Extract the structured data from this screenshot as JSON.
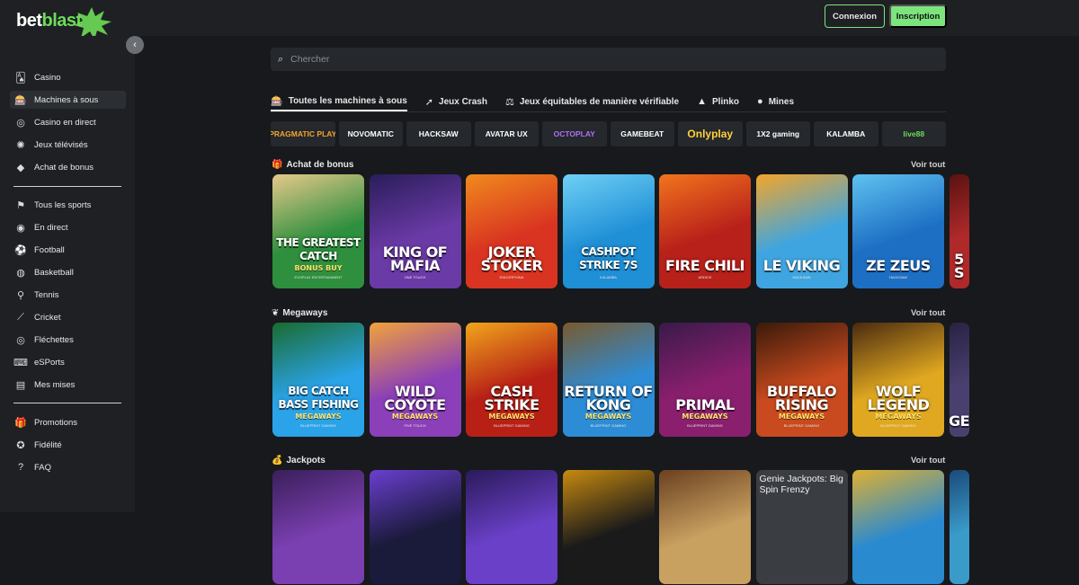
{
  "header": {
    "logo_part1": "bet",
    "logo_part2": "blast",
    "login_label": "Connexion",
    "signup_label": "Inscription"
  },
  "sidebar": {
    "items_top": [
      {
        "label": "Casino",
        "icon": "cards-icon"
      },
      {
        "label": "Machines à sous",
        "icon": "slot-machine-icon"
      },
      {
        "label": "Casino en direct",
        "icon": "roulette-icon"
      },
      {
        "label": "Jeux télévisés",
        "icon": "wheel-icon"
      },
      {
        "label": "Achat de bonus",
        "icon": "diamond-icon"
      }
    ],
    "items_sports": [
      {
        "label": "Tous les sports",
        "icon": "sports-icon"
      },
      {
        "label": "En direct",
        "icon": "live-icon"
      },
      {
        "label": "Football",
        "icon": "football-icon"
      },
      {
        "label": "Basketball",
        "icon": "basketball-icon"
      },
      {
        "label": "Tennis",
        "icon": "tennis-icon"
      },
      {
        "label": "Cricket",
        "icon": "cricket-icon"
      },
      {
        "label": "Fléchettes",
        "icon": "darts-icon"
      },
      {
        "label": "eSPorts",
        "icon": "gamepad-icon"
      },
      {
        "label": "Mes mises",
        "icon": "ticket-icon"
      }
    ],
    "items_bottom": [
      {
        "label": "Promotions",
        "icon": "gift-icon"
      },
      {
        "label": "Fidélité",
        "icon": "star-icon"
      },
      {
        "label": "FAQ",
        "icon": "faq-icon"
      }
    ]
  },
  "search": {
    "placeholder": "Chercher"
  },
  "tabs": [
    {
      "label": "Toutes les machines à sous",
      "icon": "slot-machine-icon"
    },
    {
      "label": "Jeux Crash",
      "icon": "rocket-icon"
    },
    {
      "label": "Jeux équitables de manière vérifiable",
      "icon": "scale-icon"
    },
    {
      "label": "Plinko",
      "icon": "triangle-icon"
    },
    {
      "label": "Mines",
      "icon": "bomb-icon"
    }
  ],
  "providers": [
    "PRAGMATIC PLAY",
    "NOVOMATIC",
    "HACKSAW",
    "AVATAR UX",
    "OCTOPLAY",
    "GAMEBEAT",
    "Onlyplay",
    "1X2 gaming",
    "KALAMBA",
    "live88"
  ],
  "sections": [
    {
      "title": "Achat de bonus",
      "icon": "gift-icon",
      "see_all": "Voir tout",
      "games": [
        {
          "t1": "THE GREATEST CATCH",
          "t2": "BONUS BUY",
          "t3": "EVOPLAY ENTERTAINMENT",
          "bg": "#2e8f3e",
          "bg2": "#e6c98a"
        },
        {
          "t1": "KING OF MAFIA",
          "t2": "",
          "t3": "ONE TOUCH",
          "bg": "#6a3aa6",
          "bg2": "#2a1d5a"
        },
        {
          "t1": "JOKER STOKER",
          "t2": "",
          "t3": "ENDORPHINA",
          "bg": "#d93421",
          "bg2": "#f08a1d"
        },
        {
          "t1": "CASHPOT STRIKE 7S",
          "t2": "",
          "t3": "KALAMBA",
          "bg": "#1f8fd6",
          "bg2": "#6fd0f5"
        },
        {
          "t1": "FIRE CHILI",
          "t2": "",
          "t3": "ARDICE",
          "bg": "#b8201a",
          "bg2": "#f2741d"
        },
        {
          "t1": "LE VIKING",
          "t2": "",
          "t3": "HACKSAW",
          "bg": "#3fa5e0",
          "bg2": "#f4a52a"
        },
        {
          "t1": "ZE ZEUS",
          "t2": "",
          "t3": "HACKSAW",
          "bg": "#1d6fc4",
          "bg2": "#5fc2f0"
        },
        {
          "t1": "5 S",
          "t2": "",
          "t3": "",
          "bg": "#b0292a",
          "bg2": "#5a1212"
        }
      ]
    },
    {
      "title": "Megaways",
      "icon": "ribbon-icon",
      "see_all": "Voir tout",
      "games": [
        {
          "t1": "BIG CATCH BASS FISHING",
          "t2": "MEGAWAYS",
          "t3": "BLUEPRINT GAMING",
          "bg": "#2aa3e8",
          "bg2": "#1a6b2e"
        },
        {
          "t1": "WILD COYOTE",
          "t2": "MEGAWAYS",
          "t3": "FIVE TOUCH",
          "bg": "#8b3fb8",
          "bg2": "#f2a23a"
        },
        {
          "t1": "CASH STRIKE",
          "t2": "MEGAWAYS",
          "t3": "BLUEPRINT GAMING",
          "bg": "#b82016",
          "bg2": "#f0a51c"
        },
        {
          "t1": "RETURN OF KONG",
          "t2": "MEGAWAYS",
          "t3": "BLUEPRINT GAMING",
          "bg": "#2d8cd6",
          "bg2": "#7a5a2e"
        },
        {
          "t1": "PRIMAL",
          "t2": "MEGAWAYS",
          "t3": "BLUEPRINT GAMING",
          "bg": "#8a1f6e",
          "bg2": "#3a1a4a"
        },
        {
          "t1": "BUFFALO RISING",
          "t2": "MEGAWAYS",
          "t3": "BLUEPRINT GAMING",
          "bg": "#c84a1e",
          "bg2": "#3a1a0a"
        },
        {
          "t1": "WOLF LEGEND",
          "t2": "MEGAWAYS",
          "t3": "BLUEPRINT GAMING",
          "bg": "#e0a820",
          "bg2": "#4a2a10"
        },
        {
          "t1": "GE",
          "t2": "",
          "t3": "",
          "bg": "#4a4070",
          "bg2": "#2a2244"
        }
      ]
    },
    {
      "title": "Jackpots",
      "icon": "money-bag-icon",
      "see_all": "Voir tout",
      "games": [
        {
          "t1": "",
          "t2": "",
          "t3": "",
          "bg": "#7a3fb0",
          "bg2": "#3a1f5a"
        },
        {
          "t1": "",
          "t2": "",
          "t3": "",
          "bg": "#1a1a3a",
          "bg2": "#6a3fd0"
        },
        {
          "t1": "",
          "t2": "",
          "t3": "",
          "bg": "#6a40c8",
          "bg2": "#2a1a5a"
        },
        {
          "t1": "",
          "t2": "",
          "t3": "",
          "bg": "#1a1a1a",
          "bg2": "#c88a10"
        },
        {
          "t1": "",
          "t2": "",
          "t3": "",
          "bg": "#c8a060",
          "bg2": "#6a4020"
        },
        {
          "t1": "Genie Jackpots: Big Spin Frenzy",
          "t2": "",
          "t3": "",
          "bg": "#3a3d42",
          "bg2": "#3a3d42",
          "genie": true
        },
        {
          "t1": "",
          "t2": "",
          "t3": "",
          "bg": "#2a8ad0",
          "bg2": "#e0b030"
        },
        {
          "t1": "",
          "t2": "",
          "t3": "",
          "bg": "#3a9ac8",
          "bg2": "#1a4a7a"
        }
      ]
    }
  ]
}
